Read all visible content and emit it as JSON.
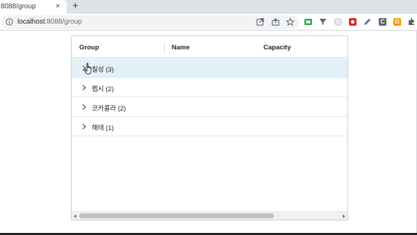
{
  "browser": {
    "tab_title": "8088/group",
    "tab_close": "×",
    "new_tab": "+",
    "url_host": "localhost",
    "url_rest": ":8088/group",
    "extensions": [
      {
        "name": "ext-green",
        "color": "#34a853"
      },
      {
        "name": "ext-filter",
        "color": "#5f6368"
      },
      {
        "name": "ext-white",
        "color": "#e8eaed"
      },
      {
        "name": "ext-red",
        "color": "#d93025"
      },
      {
        "name": "ext-blue-pen",
        "color": "#4a6fa5"
      },
      {
        "name": "ext-c",
        "color": "#5f6368",
        "text": "C"
      },
      {
        "name": "ext-orange",
        "color": "#f29900",
        "text": "G"
      },
      {
        "name": "ext-puzzle",
        "color": "#5f6368"
      }
    ]
  },
  "grid": {
    "columns": [
      {
        "key": "group",
        "label": "Group"
      },
      {
        "key": "name",
        "label": "Name"
      },
      {
        "key": "capacity",
        "label": "Capacity"
      }
    ],
    "rows": [
      {
        "label": "칠성 (3)",
        "hovered": true
      },
      {
        "label": "펩시 (2)",
        "hovered": false
      },
      {
        "label": "코카콜라 (2)",
        "hovered": false
      },
      {
        "label": "해태 (1)",
        "hovered": false
      }
    ]
  },
  "colors": {
    "row_hover": "#e1f0f9",
    "tab_strip": "#dee1e6",
    "scroll_thumb": "#c2c2c2"
  }
}
